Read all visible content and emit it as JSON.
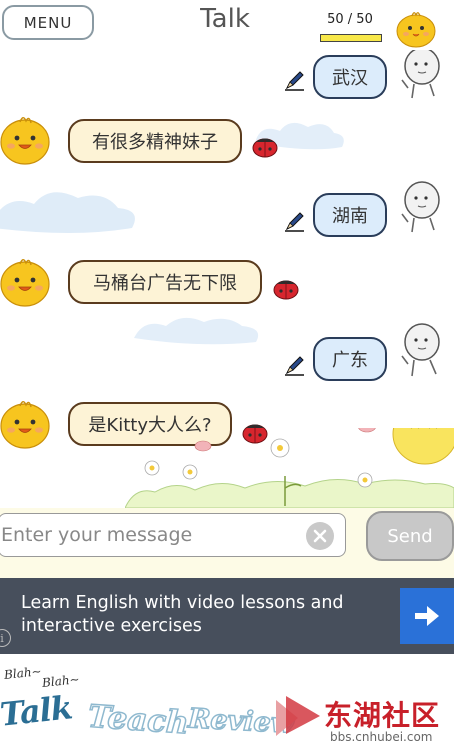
{
  "header": {
    "menu_label": "MENU",
    "title": "Talk",
    "quota_text": "50 / 50",
    "quota_fraction": 1.0
  },
  "messages": [
    {
      "side": "right",
      "text": "武汉",
      "avatar": "stickman-avatar-icon",
      "action": "pencil-icon"
    },
    {
      "side": "left",
      "text": "有很多精神妹子",
      "avatar": "chick-avatar-icon",
      "action": "ladybug-icon"
    },
    {
      "side": "right",
      "text": "湖南",
      "avatar": "stickman-avatar-icon",
      "action": "pencil-icon"
    },
    {
      "side": "left",
      "text": "马桶台广告无下限",
      "avatar": "chick-avatar-icon",
      "action": "ladybug-icon"
    },
    {
      "side": "right",
      "text": "广东",
      "avatar": "stickman-avatar-icon",
      "action": "pencil-icon"
    },
    {
      "side": "left",
      "text": "是Kitty大人么?",
      "avatar": "chick-avatar-icon",
      "action": "ladybug-icon"
    }
  ],
  "composer": {
    "placeholder": "Enter your message",
    "value": "",
    "send_label": "Send"
  },
  "ad": {
    "text": "Learn English with video lessons and interactive exercises"
  },
  "bottom_nav": {
    "blah_1": "Blah~",
    "blah_2": "Blah~",
    "tabs": [
      "Talk",
      "Teach",
      "Review"
    ],
    "active_tab": "Talk"
  },
  "watermark": {
    "name": "东湖社区",
    "url": "bbs.cnhubei.com"
  },
  "colors": {
    "bubble_in_bg": "#fdf3d6",
    "bubble_out_bg": "#dcecfb",
    "ad_bg": "#474f5c",
    "ad_button": "#2a71d8",
    "chick_yellow": "#f7c51f",
    "active_tab": "#2b6e94"
  }
}
